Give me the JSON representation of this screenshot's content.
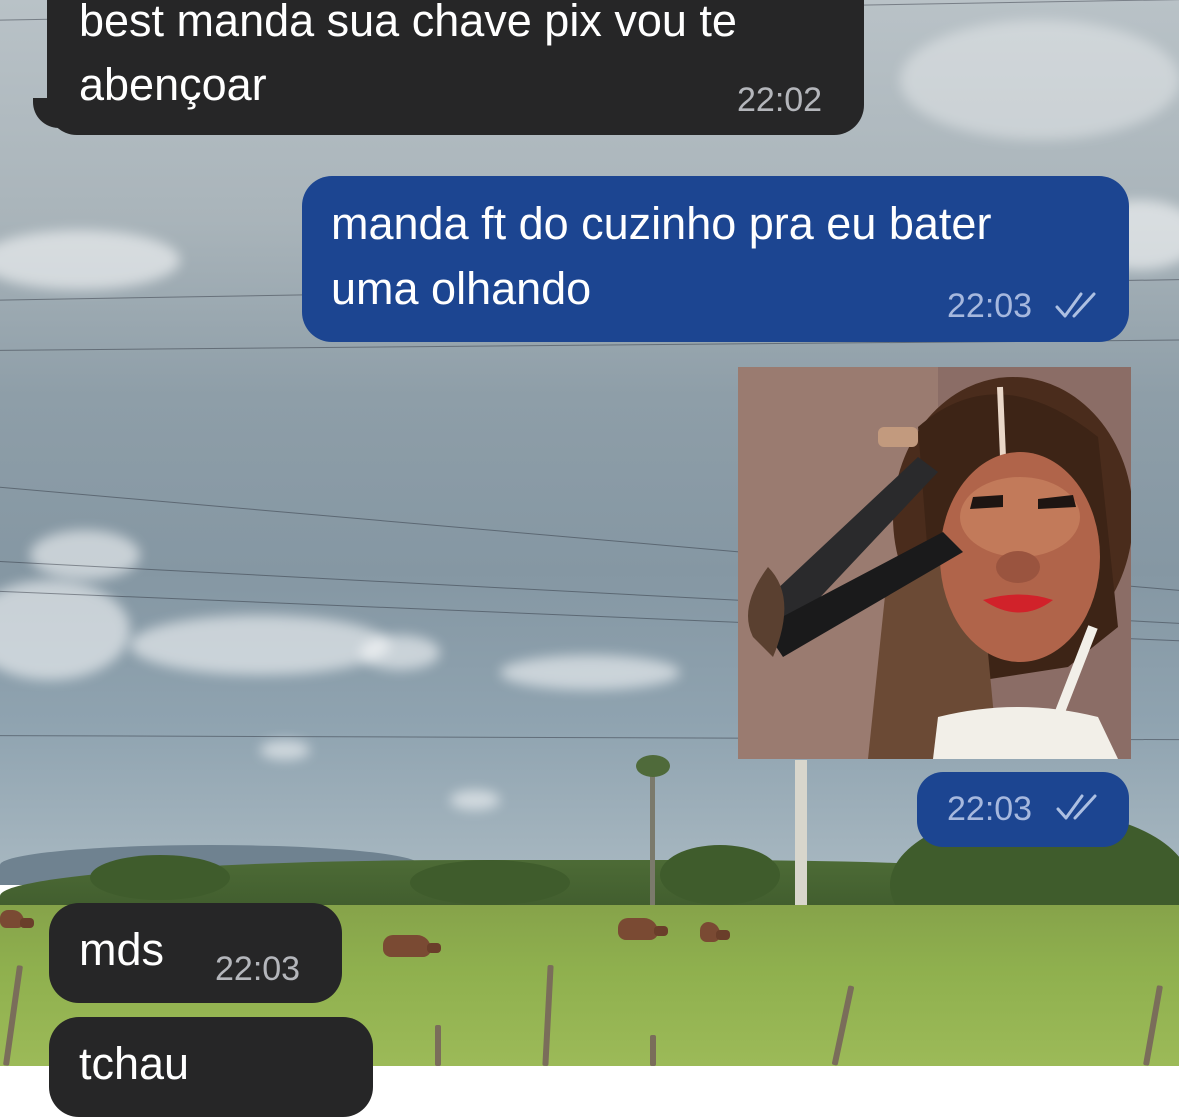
{
  "chat": {
    "messages": [
      {
        "direction": "incoming",
        "text_line1": "best manda sua chave pix vou te",
        "text_line2": "abençoar",
        "time": "22:02"
      },
      {
        "direction": "outgoing",
        "text_line1": "manda ft do cuzinho pra eu bater",
        "text_line2": "uma olhando",
        "time": "22:03",
        "status_icon": "double-check-icon"
      },
      {
        "direction": "outgoing",
        "type": "sticker",
        "sticker_icon": "monkey-sticker-image",
        "time": "22:03",
        "status_icon": "double-check-icon"
      },
      {
        "direction": "incoming",
        "text": "mds",
        "time": "22:03"
      },
      {
        "direction": "incoming",
        "text": "tchau"
      }
    ]
  },
  "colors": {
    "incoming_bubble": "#262627",
    "outgoing_bubble": "#1c4591",
    "text": "#ffffff"
  }
}
